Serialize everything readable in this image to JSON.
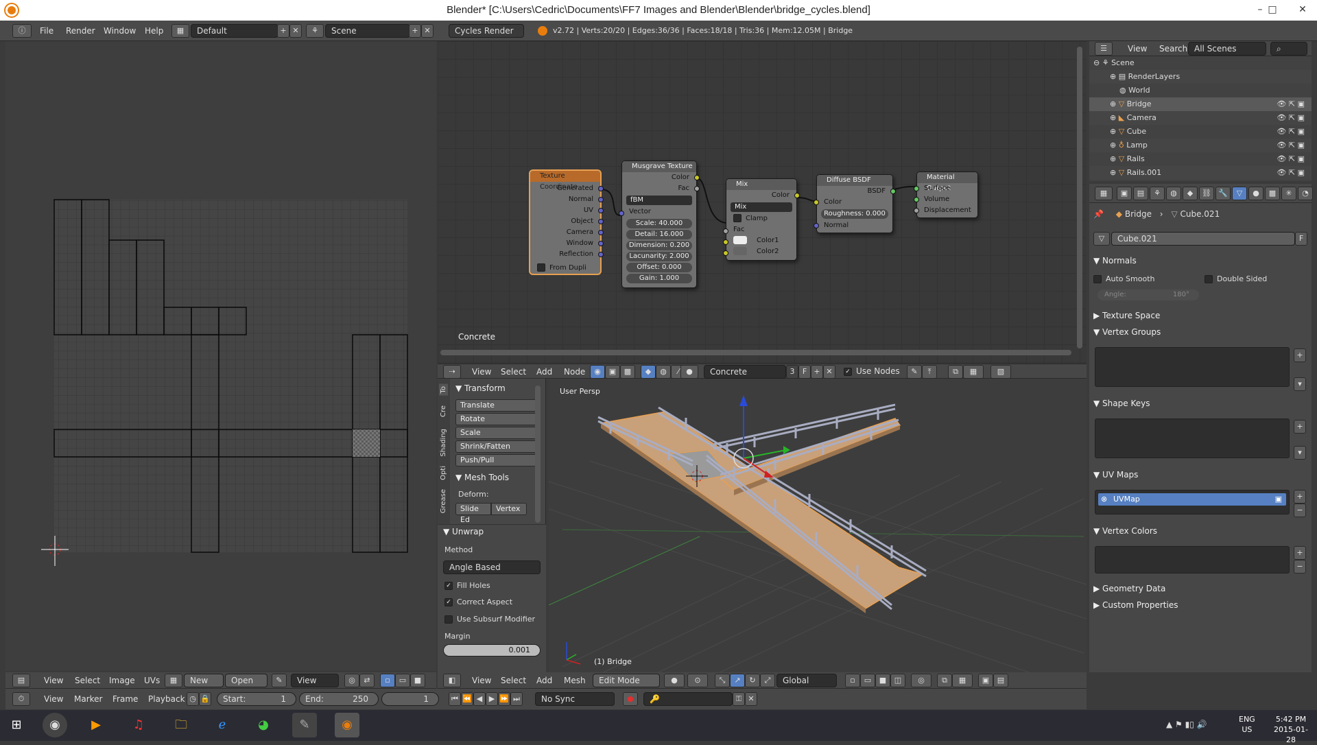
{
  "window": {
    "title": "Blender* [C:\\Users\\Cedric\\Documents\\FF7 Images and Blender\\Blender\\bridge_cycles.blend]",
    "minimize": "–",
    "maximize": "□",
    "close": "✕"
  },
  "infobar": {
    "menus": [
      "File",
      "Render",
      "Window",
      "Help"
    ],
    "layout": "Default",
    "scene": "Scene",
    "engine": "Cycles Render",
    "stats": "v2.72 | Verts:20/20 | Edges:36/36 | Faces:18/18 | Tris:36 | Mem:12.05M | Bridge"
  },
  "uv_editor": {
    "header": {
      "menus": [
        "View",
        "Select",
        "Image",
        "UVs"
      ],
      "new_label": "New",
      "open_label": "Open",
      "view_label": "View"
    }
  },
  "node_editor": {
    "material_label": "Concrete",
    "nodes": {
      "texcoord": {
        "title": "Texture Coordinate",
        "outputs": [
          "Generated",
          "Normal",
          "UV",
          "Object",
          "Camera",
          "Window",
          "Reflection"
        ],
        "from_dupli": "From Dupli"
      },
      "musgrave": {
        "title": "Musgrave Texture",
        "outputs": [
          "Color",
          "Fac"
        ],
        "type": "fBM",
        "vector": "Vector",
        "fields": [
          {
            "label": "Scale:",
            "value": "40.000"
          },
          {
            "label": "Detail:",
            "value": "16.000"
          },
          {
            "label": "Dimension:",
            "value": "0.200"
          },
          {
            "label": "Lacunarity:",
            "value": "2.000"
          },
          {
            "label": "Offset:",
            "value": "0.000"
          },
          {
            "label": "Gain:",
            "value": "1.000"
          }
        ]
      },
      "mix": {
        "title": "Mix",
        "output": "Color",
        "blend": "Mix",
        "clamp": "Clamp",
        "fac": "Fac",
        "color1": "Color1",
        "color2": "Color2"
      },
      "diffuse": {
        "title": "Diffuse BSDF",
        "output": "BSDF",
        "color": "Color",
        "roughness": "Roughness:",
        "roughness_value": "0.000",
        "normal": "Normal"
      },
      "output": {
        "title": "Material Output",
        "inputs": [
          "Surface",
          "Volume",
          "Displacement"
        ]
      }
    },
    "header": {
      "menus": [
        "View",
        "Select",
        "Add",
        "Node"
      ],
      "material": "Concrete",
      "users": "3",
      "fake": "F",
      "use_nodes": "Use Nodes"
    }
  },
  "toolshelf": {
    "tabs": [
      "To",
      "Cre",
      "Shading",
      "Opti",
      "Grease"
    ],
    "transform": {
      "title": "Transform",
      "buttons": [
        "Translate",
        "Rotate",
        "Scale",
        "Shrink/Fatten",
        "Push/Pull"
      ]
    },
    "mesh_tools": {
      "title": "Mesh Tools",
      "deform": "Deform:",
      "slide": "Slide Ed",
      "vertex": "Vertex"
    },
    "unwrap": {
      "title": "Unwrap",
      "method_label": "Method",
      "method": "Angle Based",
      "fill_holes": "Fill Holes",
      "correct_aspect": "Correct Aspect",
      "subsurf": "Use Subsurf Modifier",
      "margin_label": "Margin",
      "margin": "0.001"
    }
  },
  "viewport": {
    "label": "User Persp",
    "object": "(1) Bridge",
    "header": {
      "menus": [
        "View",
        "Select",
        "Add",
        "Mesh"
      ],
      "mode": "Edit Mode",
      "orientation": "Global"
    }
  },
  "outliner": {
    "header": {
      "view": "View",
      "search": "Search",
      "filter": "All Scenes"
    },
    "items": [
      {
        "name": "Scene",
        "indent": 0,
        "icon": "scene-icon"
      },
      {
        "name": "RenderLayers",
        "indent": 1,
        "icon": "render-layers-icon"
      },
      {
        "name": "World",
        "indent": 1,
        "icon": "world-icon"
      },
      {
        "name": "Bridge",
        "indent": 1,
        "icon": "mesh-object-icon"
      },
      {
        "name": "Camera",
        "indent": 1,
        "icon": "camera-icon"
      },
      {
        "name": "Cube",
        "indent": 1,
        "icon": "mesh-object-icon"
      },
      {
        "name": "Lamp",
        "indent": 1,
        "icon": "lamp-icon"
      },
      {
        "name": "Rails",
        "indent": 1,
        "icon": "mesh-object-icon"
      },
      {
        "name": "Rails.001",
        "indent": 1,
        "icon": "mesh-object-icon"
      }
    ]
  },
  "properties": {
    "breadcrumb": [
      "Bridge",
      "Cube.021"
    ],
    "mesh_name": "Cube.021",
    "fake_user": "F",
    "normals": {
      "title": "Normals",
      "auto_smooth": "Auto Smooth",
      "double_sided": "Double Sided",
      "angle_label": "Angle:",
      "angle_value": "180°"
    },
    "texture_space": "Texture Space",
    "vertex_groups": "Vertex Groups",
    "shape_keys": "Shape Keys",
    "uv_maps": "UV Maps",
    "uv_map_item": "UVMap",
    "vertex_colors": "Vertex Colors",
    "geometry_data": "Geometry Data",
    "custom_properties": "Custom Properties"
  },
  "timeline": {
    "menus": [
      "View",
      "Marker",
      "Frame",
      "Playback"
    ],
    "start_label": "Start:",
    "start": "1",
    "end_label": "End:",
    "end": "250",
    "current": "1",
    "sync": "No Sync"
  },
  "taskbar": {
    "lang": "ENG",
    "region": "US",
    "time": "5:42 PM",
    "date": "2015-01-28"
  },
  "colors": {
    "selected_orange": "#e8a050",
    "uv_edge": "#000000",
    "active_blue": "#5680c2"
  }
}
